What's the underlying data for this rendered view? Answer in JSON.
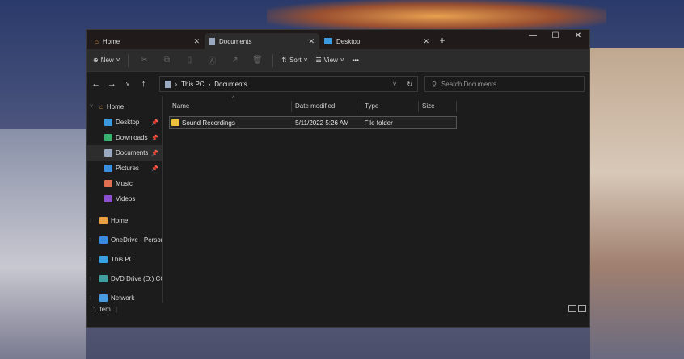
{
  "tabs": [
    {
      "label": "Home",
      "icon": "home-icon"
    },
    {
      "label": "Documents",
      "icon": "documents-icon"
    },
    {
      "label": "Desktop",
      "icon": "desktop-icon"
    }
  ],
  "tab_close": "✕",
  "new_tab": "+",
  "window_controls": {
    "minimize": "—",
    "maximize": "☐",
    "close": "✕"
  },
  "toolbar": {
    "new": "New",
    "sort": "Sort",
    "view": "View",
    "more": "•••"
  },
  "address": {
    "path": [
      "This PC",
      "Documents"
    ],
    "search_placeholder": "Search Documents"
  },
  "sidebar": {
    "quick": [
      {
        "label": "Home",
        "color": "#e8a040"
      }
    ],
    "pinned": [
      {
        "label": "Desktop",
        "color": "#3a9ae0"
      },
      {
        "label": "Downloads",
        "color": "#3ab070"
      },
      {
        "label": "Documents",
        "color": "#9aa8c0"
      },
      {
        "label": "Pictures",
        "color": "#3a90e0"
      },
      {
        "label": "Music",
        "color": "#e07050"
      },
      {
        "label": "Videos",
        "color": "#8a50d0"
      }
    ],
    "roots": [
      {
        "label": "Home",
        "color": "#e8a040"
      },
      {
        "label": "OneDrive - Personal",
        "color": "#3a8ae0"
      },
      {
        "label": "This PC",
        "color": "#3aa0e0"
      },
      {
        "label": "DVD Drive (D:) CCCOMA",
        "color": "#40a0a0"
      },
      {
        "label": "Network",
        "color": "#4a9ae0"
      }
    ]
  },
  "columns": [
    "Name",
    "Date modified",
    "Type",
    "Size"
  ],
  "files": [
    {
      "name": "Sound Recordings",
      "date": "5/11/2022 5:26 AM",
      "type": "File folder",
      "size": ""
    }
  ],
  "status": {
    "count": "1 item",
    "sep": "|"
  }
}
